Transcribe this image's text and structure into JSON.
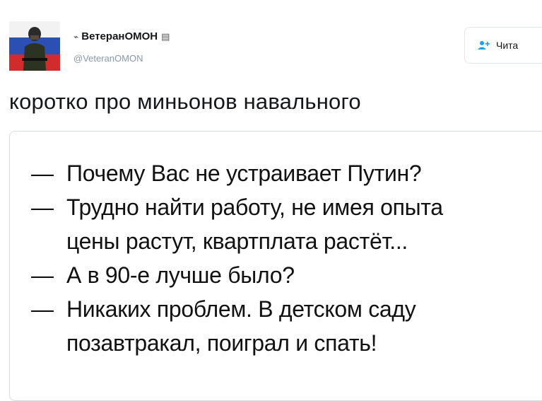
{
  "author": {
    "display_name": "ВетеранОМОН",
    "handle": "@VeteranOMON",
    "pre_icon": "⌁",
    "post_icon": "▤"
  },
  "follow_button": {
    "label": "Чита",
    "icon": "user-plus-icon",
    "icon_glyph": "⁺"
  },
  "tweet": {
    "text": "коротко про миньонов навального"
  },
  "image_text": {
    "lines": [
      {
        "dash": "—",
        "text": "Почему Вас не устраивает Путин?"
      },
      {
        "dash": "—",
        "text": "Трудно найти работу, не имея опыта"
      },
      {
        "dash": "",
        "text": "цены растут, квартплата растёт..."
      },
      {
        "dash": "—",
        "text": "А в 90-е лучше было?"
      },
      {
        "dash": "—",
        "text": "Никаких проблем. В детском саду"
      },
      {
        "dash": "",
        "text": "позавтракал, поиграл и спать!"
      }
    ]
  },
  "colors": {
    "follow_icon": "#1da1f2",
    "handle": "#8899a6",
    "border": "#d6dde2"
  }
}
